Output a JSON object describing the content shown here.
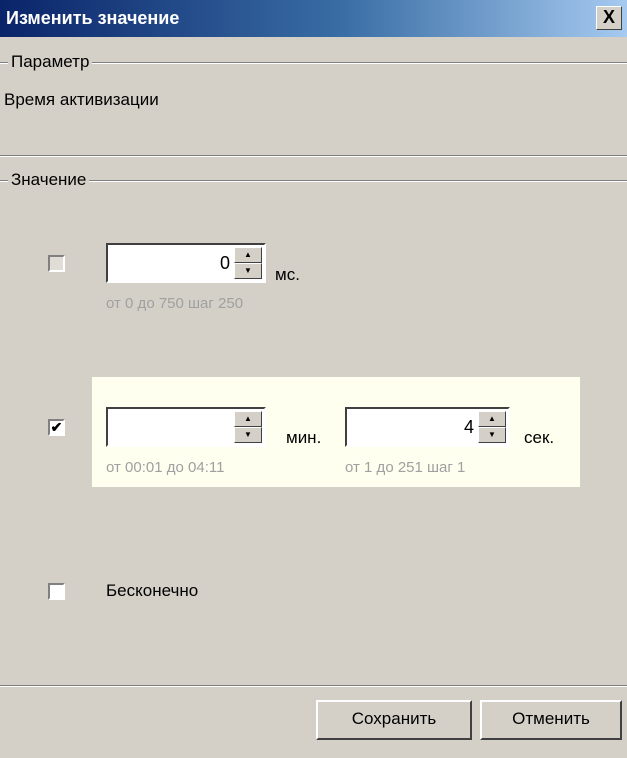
{
  "dialog": {
    "title": "Изменить значение",
    "close_label": "X"
  },
  "parameter": {
    "group_label": "Параметр",
    "name": "Время активизации"
  },
  "value": {
    "group_label": "Значение",
    "ms_row": {
      "checked": false,
      "input_value": "0",
      "unit": "мс.",
      "hint": "от 0 до 750 шаг 250"
    },
    "time_row": {
      "checked": true,
      "check_mark": "✔",
      "minutes_value": "",
      "minutes_unit": "мин.",
      "minutes_hint": "от 00:01 до 04:11",
      "seconds_value": "4",
      "seconds_unit": "сек.",
      "seconds_hint": "от 1 до 251 шаг 1"
    },
    "infinite_row": {
      "checked": false,
      "label": "Бесконечно"
    }
  },
  "buttons": {
    "save": "Сохранить",
    "cancel": "Отменить"
  },
  "colors": {
    "title_start": "#0a246a",
    "highlight": "#fffff0",
    "face": "#d4d0c8"
  }
}
